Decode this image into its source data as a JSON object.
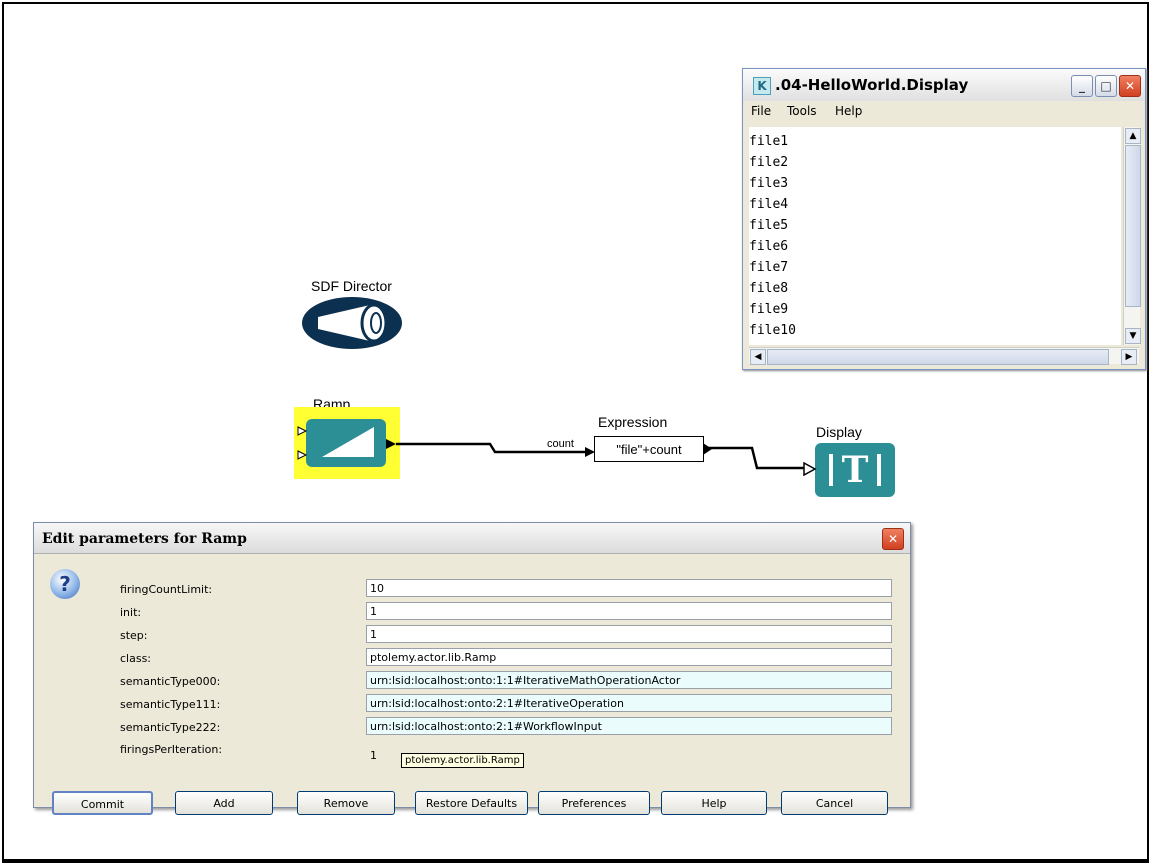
{
  "display_window": {
    "logo": "K",
    "title": ".04-HelloWorld.Display",
    "minimize_glyph": "_",
    "maximize_glyph": "□",
    "close_glyph": "✕",
    "menu": [
      "File",
      "Tools",
      "Help"
    ],
    "lines": [
      "file1",
      "file2",
      "file3",
      "file4",
      "file5",
      "file6",
      "file7",
      "file8",
      "file9",
      "file10"
    ]
  },
  "canvas": {
    "director_label": "SDF Director",
    "ramp_label": "Ramp",
    "expression_label": "Expression",
    "expression_text": "\"file\"+count",
    "port_count_label": "count",
    "display_label": "Display",
    "display_icon_text": "T"
  },
  "dialog": {
    "title": "Edit parameters for Ramp",
    "close_glyph": "✕",
    "help_glyph": "?",
    "params": [
      {
        "label": "firingCountLimit:",
        "value": "10"
      },
      {
        "label": "init:",
        "value": "1"
      },
      {
        "label": "step:",
        "value": "1"
      },
      {
        "label": "class:",
        "value": "ptolemy.actor.lib.Ramp"
      },
      {
        "label": "semanticType000:",
        "value": "urn:lsid:localhost:onto:1:1#IterativeMathOperationActor"
      },
      {
        "label": "semanticType111:",
        "value": "urn:lsid:localhost:onto:2:1#IterativeOperation"
      },
      {
        "label": "semanticType222:",
        "value": "urn:lsid:localhost:onto:2:1#WorkflowInput"
      },
      {
        "label": "firingsPerIteration:",
        "value": "1"
      }
    ],
    "tooltip": "ptolemy.actor.lib.Ramp",
    "buttons": {
      "commit": "Commit",
      "add": "Add",
      "remove": "Remove",
      "restore": "Restore Defaults",
      "preferences": "Preferences",
      "help": "Help",
      "cancel": "Cancel"
    }
  }
}
